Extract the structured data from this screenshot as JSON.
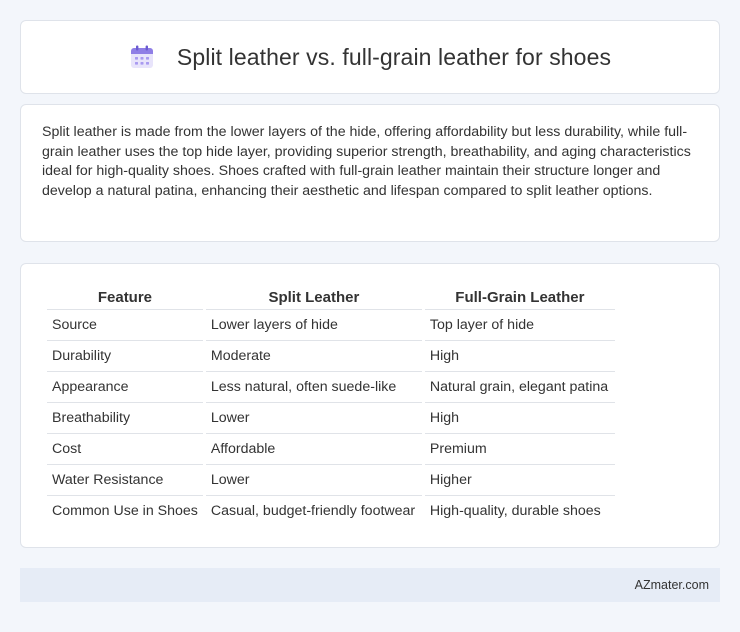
{
  "header": {
    "icon": "calendar-icon",
    "title": "Split leather vs. full-grain leather for shoes"
  },
  "summary": {
    "text": "Split leather is made from the lower layers of the hide, offering affordability but less durability, while full-grain leather uses the top hide layer, providing superior strength, breathability, and aging characteristics ideal for high-quality shoes. Shoes crafted with full-grain leather maintain their structure longer and develop a natural patina, enhancing their aesthetic and lifespan compared to split leather options."
  },
  "table": {
    "headers": [
      "Feature",
      "Split Leather",
      "Full-Grain Leather"
    ],
    "rows": [
      [
        "Source",
        "Lower layers of hide",
        "Top layer of hide"
      ],
      [
        "Durability",
        "Moderate",
        "High"
      ],
      [
        "Appearance",
        "Less natural, often suede-like",
        "Natural grain, elegant patina"
      ],
      [
        "Breathability",
        "Lower",
        "High"
      ],
      [
        "Cost",
        "Affordable",
        "Premium"
      ],
      [
        "Water Resistance",
        "Lower",
        "Higher"
      ],
      [
        "Common Use in Shoes",
        "Casual, budget-friendly footwear",
        "High-quality, durable shoes"
      ]
    ]
  },
  "footer": {
    "brand": "AZmater.com"
  },
  "colors": {
    "background": "#f3f6fb",
    "card": "#ffffff",
    "footer": "#e6ecf6",
    "icon_accent": "#8f7ee6"
  }
}
